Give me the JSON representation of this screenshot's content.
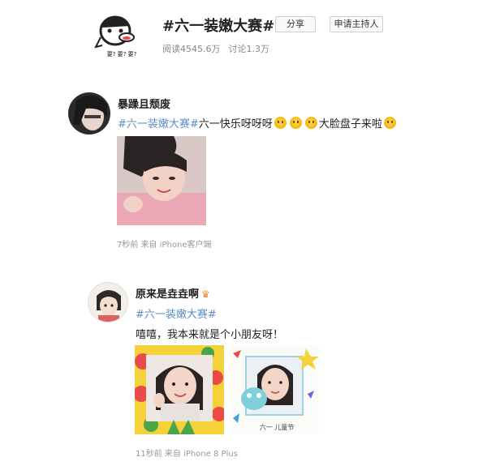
{
  "topic": {
    "title": "#六一装嫩大赛#",
    "reads": "阅读4545.6万",
    "discussions": "讨论1.3万",
    "avatar_caption": "要? 要? 要?",
    "share_label": "分享",
    "host_label": "申请主持人"
  },
  "posts": [
    {
      "user": "暴躁且颓废",
      "hashtag": "#六一装嫩大赛#",
      "text_prefix": "六一快乐呀呀呀",
      "text_suffix": "大脸盘子来啦",
      "meta": "7秒前 来自 iPhone客户端"
    },
    {
      "user": "原来是垚垚啊",
      "hashtag": "#六一装嫩大赛#",
      "text": "嘻嘻，我本来就是个小朋友呀！",
      "photo2_caption": "六一 儿童节",
      "meta": "11秒前 来自 iPhone 8 Plus"
    }
  ]
}
